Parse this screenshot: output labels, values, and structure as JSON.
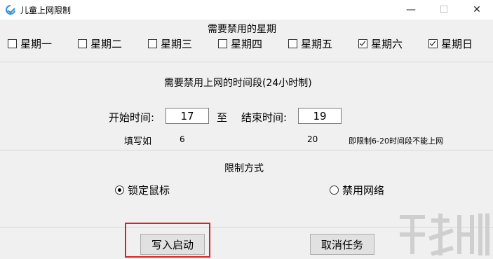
{
  "window": {
    "title": "儿童上网限制",
    "icon": "app-logo-icon",
    "controls": {
      "minimize": "—",
      "maximize": "☐",
      "close": "✕"
    }
  },
  "days_section": {
    "title": "需要禁用的星期",
    "days": [
      {
        "label": "星期一",
        "checked": false
      },
      {
        "label": "星期二",
        "checked": false
      },
      {
        "label": "星期三",
        "checked": false
      },
      {
        "label": "星期四",
        "checked": false
      },
      {
        "label": "星期五",
        "checked": false
      },
      {
        "label": "星期六",
        "checked": true
      },
      {
        "label": "星期日",
        "checked": true
      }
    ]
  },
  "time_section": {
    "title": "需要禁用上网的时间段(24小时制)",
    "start_label": "开始时间:",
    "start_value": "17",
    "to_label": "至",
    "end_label": "结束时间:",
    "end_value": "19",
    "example_label": "填写如",
    "example_start": "6",
    "example_end": "20",
    "example_note": "即限制6-20时间段不能上网"
  },
  "mode_section": {
    "title": "限制方式",
    "options": [
      {
        "label": "锁定鼠标",
        "selected": true
      },
      {
        "label": "禁用网络",
        "selected": false
      }
    ]
  },
  "actions": {
    "write_start": "写入启动",
    "cancel_task": "取消任务"
  },
  "colors": {
    "highlight": "#e02020",
    "window_bg": "#f0f0f0"
  }
}
